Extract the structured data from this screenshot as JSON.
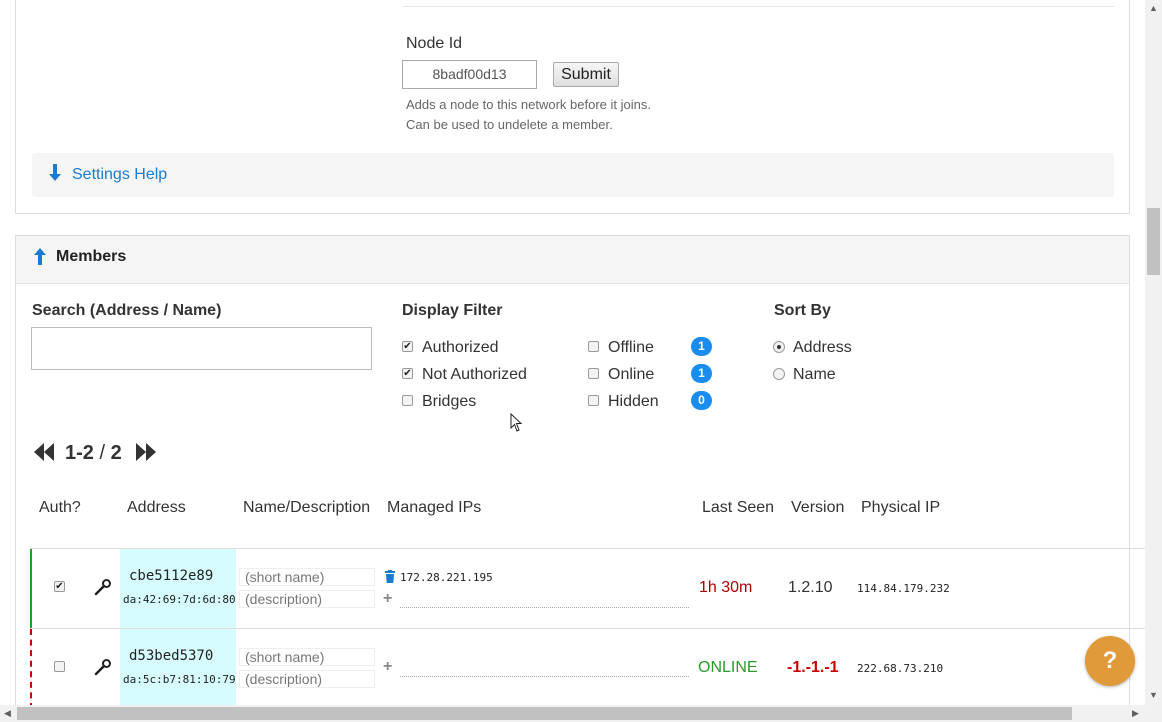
{
  "add_member": {
    "node_id_label": "Node Id",
    "node_id_value": "8badf00d13",
    "submit_label": "Submit",
    "help_line1": "Adds a node to this network before it joins.",
    "help_line2": "Can be used to undelete a member."
  },
  "settings_help": {
    "label": "Settings Help",
    "icon": "arrow-down-icon"
  },
  "members": {
    "title": "Members",
    "search_label": "Search (Address / Name)",
    "search_value": "",
    "display_filter_label": "Display Filter",
    "sort_by_label": "Sort By",
    "filters": [
      {
        "label": "Authorized",
        "checked": true
      },
      {
        "label": "Not Authorized",
        "checked": true
      },
      {
        "label": "Bridges",
        "checked": false
      },
      {
        "label": "Offline",
        "checked": false,
        "count": "1"
      },
      {
        "label": "Online",
        "checked": false,
        "count": "1"
      },
      {
        "label": "Hidden",
        "checked": false,
        "count": "0"
      }
    ],
    "sort_options": [
      {
        "label": "Address",
        "selected": true
      },
      {
        "label": "Name",
        "selected": false
      }
    ],
    "pager": {
      "range": "1-2",
      "separator": " / ",
      "total": "2"
    },
    "columns": [
      "Auth?",
      "Address",
      "Name/Description",
      "Managed IPs",
      "Last Seen",
      "Version",
      "Physical IP"
    ],
    "rows": [
      {
        "authorized": true,
        "address": "cbe5112e89",
        "mac": "da:42:69:7d:6d:80",
        "name_placeholder": "(short name)",
        "desc_placeholder": "(description)",
        "managed_ip": "172.28.221.195",
        "last_seen": "1h 30m",
        "version": "1.2.10",
        "physical_ip": "114.84.179.232"
      },
      {
        "authorized": false,
        "address": "d53bed5370",
        "mac": "da:5c:b7:81:10:79",
        "name_placeholder": "(short name)",
        "desc_placeholder": "(description)",
        "managed_ip": "",
        "last_seen": "ONLINE",
        "version": "-1.-1.-1",
        "physical_ip": "222.68.73.210"
      }
    ]
  },
  "help_button": {
    "label": "?"
  },
  "colors": {
    "link": "#1a7bd0",
    "badge": "#1a8cf0",
    "address_bg": "#d6fcfd",
    "fab": "#e09a3a"
  }
}
